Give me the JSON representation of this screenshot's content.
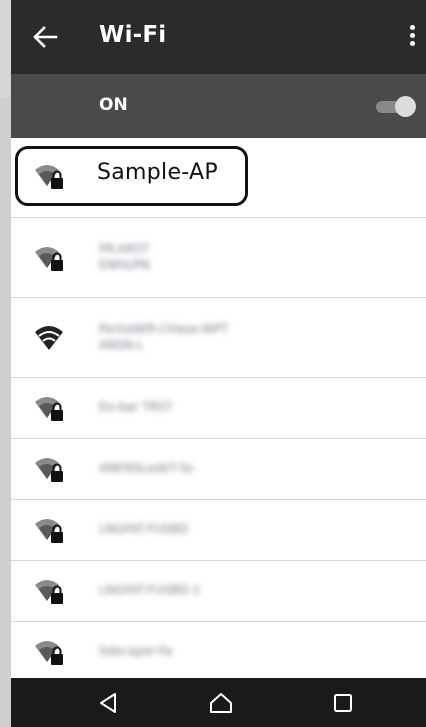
{
  "header": {
    "title": "Wi-Fi"
  },
  "wifi_toggle": {
    "label": "ON",
    "state": "on"
  },
  "networks": [
    {
      "name": "Sample-AP",
      "secured": true,
      "selected": true
    },
    {
      "name": "PR-AR5T",
      "secondary": "ENFA/PN",
      "secured": true,
      "blurred": true
    },
    {
      "name": "PentaWifi-CHase-WPT",
      "secondary": "ANSN-L",
      "secured": false,
      "blurred": true
    },
    {
      "name": "Eo-bar TRST",
      "secured": true,
      "blurred": true
    },
    {
      "name": "ANENSLodeT-Ss",
      "secured": true,
      "blurred": true
    },
    {
      "name": "LNGFAT-FUSBD",
      "secured": true,
      "blurred": true
    },
    {
      "name": "LNGFAT-FUSBD-1",
      "secured": true,
      "blurred": true
    },
    {
      "name": "Sdecaper-Fa",
      "secured": true,
      "blurred": true
    }
  ],
  "navigation": {
    "back": "back-triangle",
    "home": "home-outline",
    "recents": "square-outline"
  },
  "colors": {
    "appbar": "#2b2b2b",
    "subbar": "#4a4a4a",
    "navbar": "#1a1a1a"
  }
}
